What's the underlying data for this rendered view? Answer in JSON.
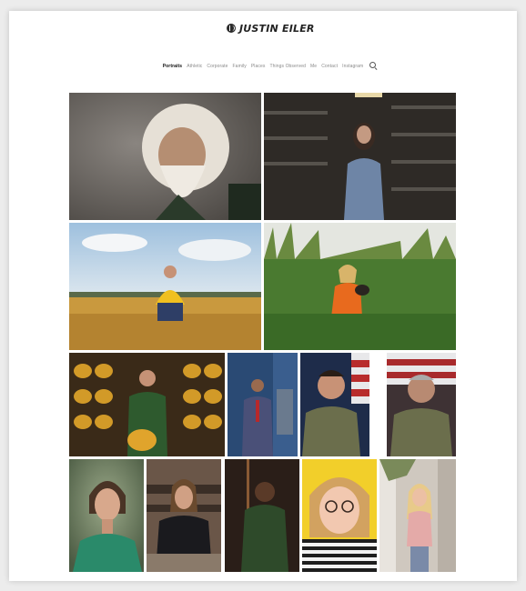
{
  "brand": {
    "name": "JUSTIN EILER"
  },
  "nav": {
    "items": [
      {
        "label": "Portraits",
        "active": true
      },
      {
        "label": "Athletic",
        "active": false
      },
      {
        "label": "Corporate",
        "active": false
      },
      {
        "label": "Family",
        "active": false
      },
      {
        "label": "Places",
        "active": false
      },
      {
        "label": "Things Observed",
        "active": false
      },
      {
        "label": "Me",
        "active": false
      },
      {
        "label": "Contact",
        "active": false
      },
      {
        "label": "Instagram",
        "active": false
      }
    ],
    "search_icon": "search-icon"
  },
  "gallery": {
    "photos": [
      {
        "subject": "elderly man with white hair and beard",
        "palette": [
          "#6e6a66",
          "#e8e2d8"
        ]
      },
      {
        "subject": "woman in library stacks",
        "palette": [
          "#2a2622",
          "#7a8ea8"
        ]
      },
      {
        "subject": "man in yellow shirt in wheat field",
        "palette": [
          "#c79a3e",
          "#eec02a"
        ]
      },
      {
        "subject": "woman in orange vest in tall grass",
        "palette": [
          "#3f6a2a",
          "#e0701e"
        ]
      },
      {
        "subject": "man in green sweatshirt with football helmets",
        "palette": [
          "#3a2a16",
          "#d49a28"
        ]
      },
      {
        "subject": "man in suit in laboratory",
        "palette": [
          "#2a4a72",
          "#4a5a88"
        ]
      },
      {
        "subject": "soldier in camouflage with flag",
        "palette": [
          "#24324e",
          "#6b6e4c"
        ]
      },
      {
        "subject": "older soldier in camouflage with flag",
        "palette": [
          "#4a3a3a",
          "#6b6e4c"
        ]
      },
      {
        "subject": "woman in green dress",
        "palette": [
          "#7a8a6a",
          "#2f8a6e"
        ]
      },
      {
        "subject": "woman in black jacket in classroom",
        "palette": [
          "#5a4a3e",
          "#1a1a1a"
        ]
      },
      {
        "subject": "man holding staff in dark room",
        "palette": [
          "#2a1e18",
          "#2e4a2a"
        ]
      },
      {
        "subject": "girl with glasses on yellow background",
        "palette": [
          "#f2cf2a",
          "#1e1e1e"
        ]
      },
      {
        "subject": "woman in pink top on porch",
        "palette": [
          "#c8c2ba",
          "#e4b4b0"
        ]
      }
    ]
  }
}
